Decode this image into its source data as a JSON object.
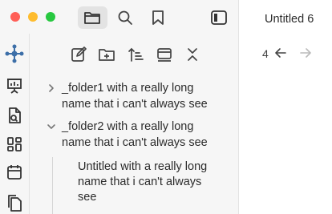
{
  "window": {
    "traffic_lights": {
      "close_color": "#ff5f57",
      "minimize_color": "#febc2e",
      "zoom_color": "#28c840"
    }
  },
  "titlebar": {
    "icons": [
      "files-icon",
      "search-icon",
      "bookmark-icon",
      "sidebar-toggle-icon"
    ],
    "active_icon": "files-icon"
  },
  "ribbon": {
    "icons": [
      "graph-icon",
      "presentation-icon",
      "open-file-icon",
      "canvas-icon",
      "calendar-icon",
      "copy-icon"
    ]
  },
  "file_explorer": {
    "toolbar": [
      "new-note-icon",
      "new-folder-icon",
      "sort-icon",
      "collapse-view-icon",
      "collapse-all-icon"
    ],
    "items": [
      {
        "label_line1": "_folder1 with a really long",
        "label_line2": "name that i can't always see",
        "expanded": false
      },
      {
        "label_line1": "_folder2 with a really long",
        "label_line2": "name that i can't always see",
        "expanded": true,
        "children": [
          {
            "label_line1": "Untitled with a really long",
            "label_line2": "name that i can't always",
            "label_line3": "see"
          }
        ]
      }
    ]
  },
  "editor": {
    "tab_title": "Untitled 6",
    "nav_count": "4"
  },
  "colors": {
    "sidebar_bg": "#f6f6f6",
    "accent_graph": "#3d6fa8",
    "divider": "#e3e3e3"
  }
}
